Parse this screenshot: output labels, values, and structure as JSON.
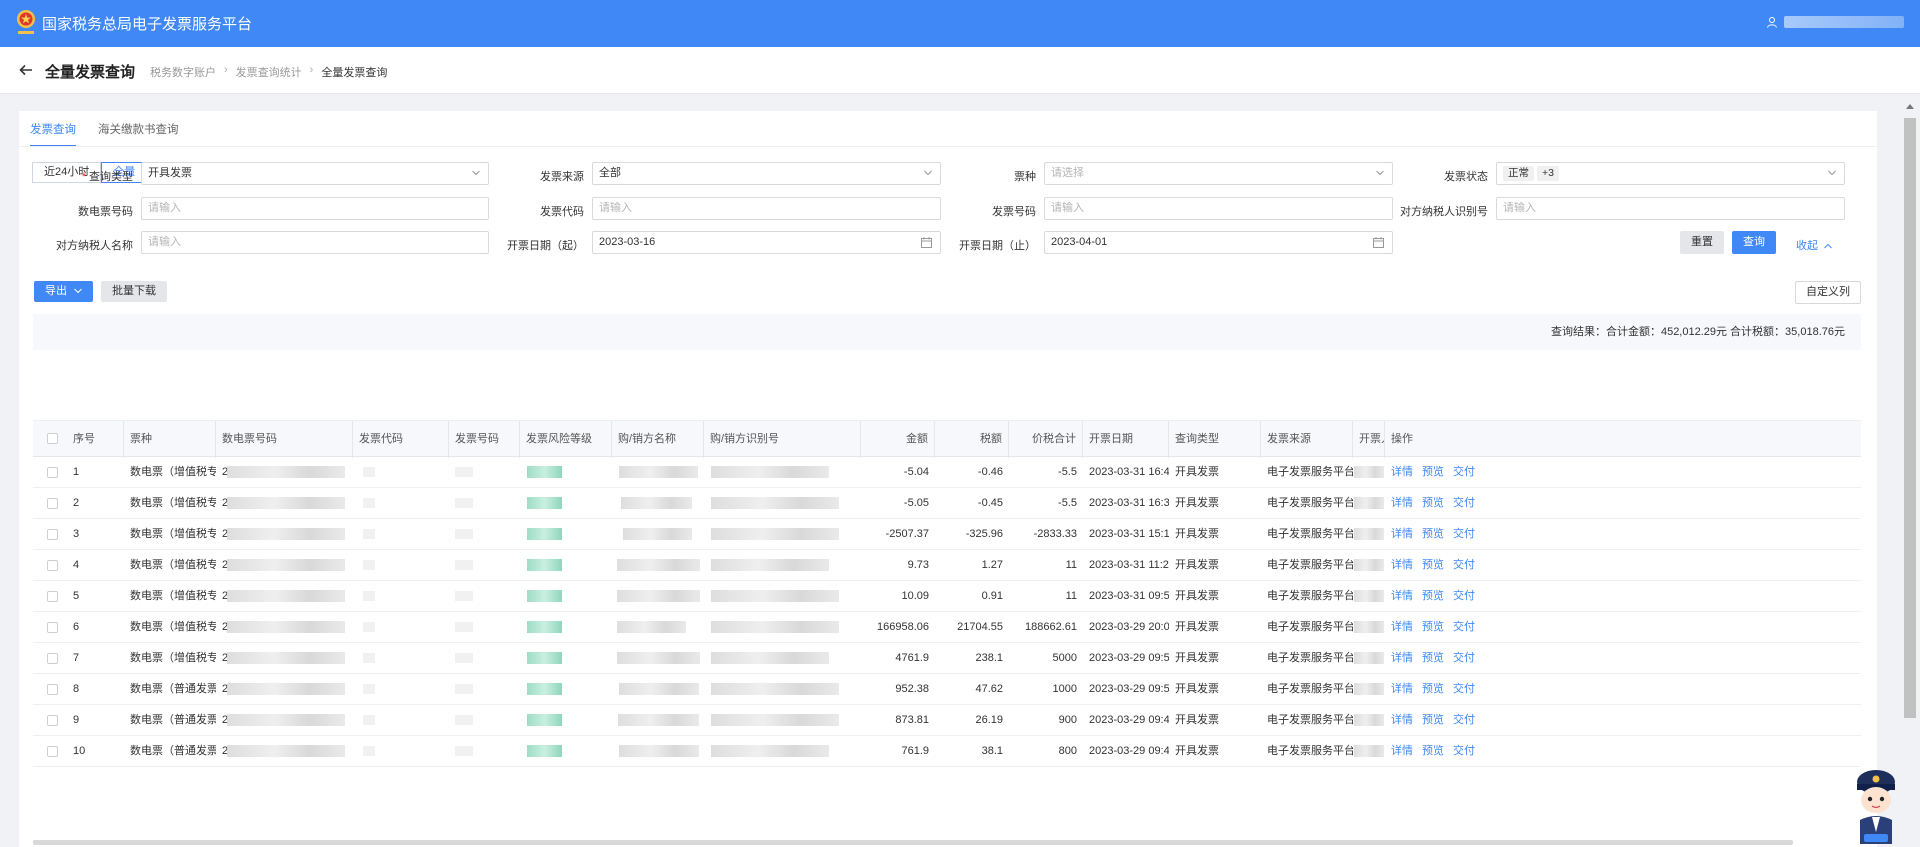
{
  "app": {
    "title": "国家税务总局电子发票服务平台"
  },
  "header": {
    "page_title": "全量发票查询",
    "breadcrumb": [
      "税务数字账户",
      "发票查询统计",
      "全量发票查询"
    ]
  },
  "tabs": [
    {
      "label": "发票查询",
      "active": true
    },
    {
      "label": "海关缴款书查询",
      "active": false
    }
  ],
  "range": [
    {
      "label": "近24小时",
      "active": false
    },
    {
      "label": "全量",
      "active": true
    }
  ],
  "filters": {
    "query_type": {
      "label": "查询类型",
      "value": "开具发票"
    },
    "source": {
      "label": "发票来源",
      "value": "全部"
    },
    "ticket_kind": {
      "label": "票种",
      "placeholder": "请选择"
    },
    "status": {
      "label": "发票状态",
      "tags": [
        "正常",
        "+3"
      ]
    },
    "digital_no": {
      "label": "数电票号码",
      "placeholder": "请输入"
    },
    "invoice_code": {
      "label": "发票代码",
      "placeholder": "请输入"
    },
    "invoice_no": {
      "label": "发票号码",
      "placeholder": "请输入"
    },
    "counterparty_id": {
      "label": "对方纳税人识别号",
      "placeholder": "请输入"
    },
    "counterparty_name": {
      "label": "对方纳税人名称",
      "placeholder": "请输入"
    },
    "date_from": {
      "label": "开票日期（起）",
      "value": "2023-03-16"
    },
    "date_to": {
      "label": "开票日期（止）",
      "value": "2023-04-01"
    }
  },
  "buttons": {
    "reset": "重置",
    "query": "查询",
    "collapse": "收起",
    "export": "导出",
    "batch_download": "批量下载",
    "custom_columns": "自定义列"
  },
  "summary": "查询结果：合计金额：452,012.29元   合计税额：35,018.76元",
  "table": {
    "columns": [
      "序号",
      "票种",
      "数电票号码",
      "发票代码",
      "发票号码",
      "发票风险等级",
      "购/销方名称",
      "购/销方识别号",
      "金额",
      "税额",
      "价税合计",
      "开票日期",
      "查询类型",
      "发票来源",
      "开票人",
      "操作"
    ],
    "row_actions": [
      "详情",
      "预览",
      "交付"
    ],
    "rows": [
      {
        "no": "1",
        "kind": "数电票（增值税专...",
        "digit": "2",
        "amount": "-5.04",
        "tax": "-0.46",
        "total": "-5.5",
        "date": "2023-03-31 16:4...",
        "qtype": "开具发票",
        "source": "电子发票服务平台"
      },
      {
        "no": "2",
        "kind": "数电票（增值税专...",
        "digit": "2",
        "amount": "-5.05",
        "tax": "-0.45",
        "total": "-5.5",
        "date": "2023-03-31 16:3...",
        "qtype": "开具发票",
        "source": "电子发票服务平台"
      },
      {
        "no": "3",
        "kind": "数电票（增值税专...",
        "digit": "2",
        "amount": "-2507.37",
        "tax": "-325.96",
        "total": "-2833.33",
        "date": "2023-03-31 15:1...",
        "qtype": "开具发票",
        "source": "电子发票服务平台"
      },
      {
        "no": "4",
        "kind": "数电票（增值税专...",
        "digit": "2",
        "amount": "9.73",
        "tax": "1.27",
        "total": "11",
        "date": "2023-03-31 11:2...",
        "qtype": "开具发票",
        "source": "电子发票服务平台"
      },
      {
        "no": "5",
        "kind": "数电票（增值税专...",
        "digit": "2",
        "amount": "10.09",
        "tax": "0.91",
        "total": "11",
        "date": "2023-03-31 09:5...",
        "qtype": "开具发票",
        "source": "电子发票服务平台"
      },
      {
        "no": "6",
        "kind": "数电票（增值税专...",
        "digit": "2",
        "amount": "166958.06",
        "tax": "21704.55",
        "total": "188662.61",
        "date": "2023-03-29 20:0...",
        "qtype": "开具发票",
        "source": "电子发票服务平台"
      },
      {
        "no": "7",
        "kind": "数电票（增值税专...",
        "digit": "2",
        "amount": "4761.9",
        "tax": "238.1",
        "total": "5000",
        "date": "2023-03-29 09:5...",
        "qtype": "开具发票",
        "source": "电子发票服务平台"
      },
      {
        "no": "8",
        "kind": "数电票（普通发票）",
        "digit": "2",
        "amount": "952.38",
        "tax": "47.62",
        "total": "1000",
        "date": "2023-03-29 09:5...",
        "qtype": "开具发票",
        "source": "电子发票服务平台"
      },
      {
        "no": "9",
        "kind": "数电票（普通发票）",
        "digit": "2",
        "amount": "873.81",
        "tax": "26.19",
        "total": "900",
        "date": "2023-03-29 09:4...",
        "qtype": "开具发票",
        "source": "电子发票服务平台"
      },
      {
        "no": "10",
        "kind": "数电票（普通发票）",
        "digit": "2",
        "amount": "761.9",
        "tax": "38.1",
        "total": "800",
        "date": "2023-03-29 09:4...",
        "qtype": "开具发票",
        "source": "电子发票服务平台"
      }
    ]
  },
  "icons": [
    "tax-emblem-icon",
    "user-icon",
    "back-arrow-icon",
    "chevron-down-icon",
    "calendar-icon",
    "chevron-up-icon",
    "mascot-icon"
  ],
  "colors": {
    "primary": "#3f88f5",
    "header_bg": "#3f88f5",
    "page_bg": "#f0f2f5"
  }
}
